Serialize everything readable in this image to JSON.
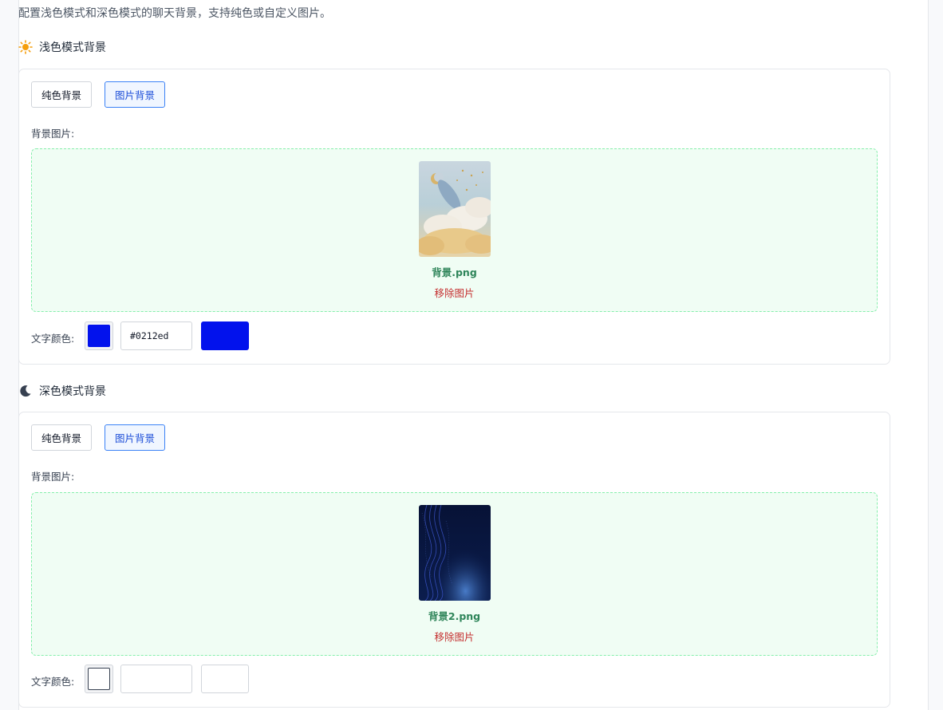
{
  "description": "配置浅色模式和深色模式的聊天背景，支持纯色或自定义图片。",
  "light": {
    "title": "浅色模式背景",
    "icon": "sun-icon",
    "solid_label": "纯色背景",
    "image_label": "图片背景",
    "selected": "image",
    "bg_image_label": "背景图片:",
    "file_name": "背景.png",
    "remove_label": "移除图片",
    "text_color_label": "文字颜色:",
    "text_color": "#0212ed"
  },
  "dark": {
    "title": "深色模式背景",
    "icon": "moon-icon",
    "solid_label": "纯色背景",
    "image_label": "图片背景",
    "selected": "image",
    "bg_image_label": "背景图片:",
    "file_name": "背景2.png",
    "remove_label": "移除图片",
    "text_color_label": "文字颜色:",
    "text_color": ""
  },
  "colors": {
    "accent": "#3b82f6",
    "success": "#2f855a",
    "danger": "#c53030"
  }
}
